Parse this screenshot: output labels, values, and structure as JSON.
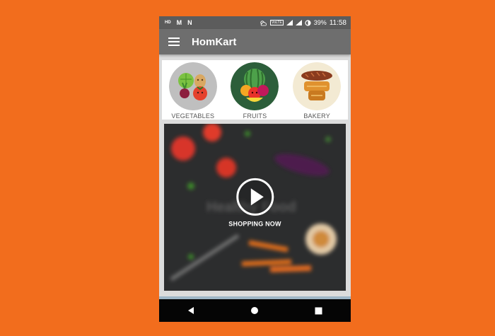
{
  "status_bar": {
    "left_indicators": [
      "HD",
      "M",
      "N"
    ],
    "volte": "VoLTE",
    "battery": "39%",
    "time": "11:58"
  },
  "app_bar": {
    "title": "HomKart"
  },
  "categories": [
    {
      "label": "VEGETABLES",
      "icon": "vegetables-icon"
    },
    {
      "label": "FRUITS",
      "icon": "fruits-icon"
    },
    {
      "label": "BAKERY",
      "icon": "bakery-icon"
    }
  ],
  "video": {
    "label": "SHOPPING NOW"
  },
  "nav": {
    "icons": [
      "back-icon",
      "home-icon",
      "recents-icon"
    ]
  },
  "colors": {
    "background": "#f26d1d",
    "status_bar": "#5c5c5c",
    "app_bar": "#6e6e6e",
    "nav_bar": "#050505"
  }
}
